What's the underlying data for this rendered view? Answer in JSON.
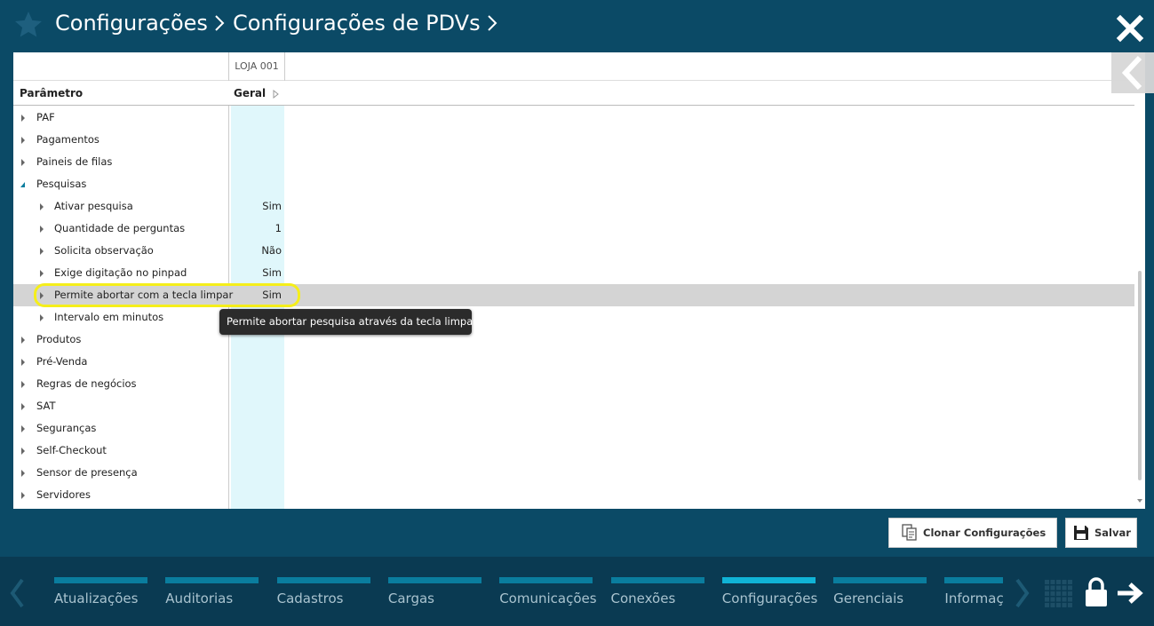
{
  "header": {
    "crumb1": "Configurações",
    "crumb2": "Configurações de PDVs"
  },
  "table": {
    "store_column": "LOJA 001",
    "param_header": "Parâmetro",
    "group_header": "Geral",
    "rows": [
      {
        "label": "PAF",
        "value": "",
        "level": 1,
        "expanded": false
      },
      {
        "label": "Pagamentos",
        "value": "",
        "level": 1,
        "expanded": false
      },
      {
        "label": "Paineis de filas",
        "value": "",
        "level": 1,
        "expanded": false
      },
      {
        "label": "Pesquisas",
        "value": "",
        "level": 1,
        "expanded": true
      },
      {
        "label": "Ativar pesquisa",
        "value": "Sim",
        "level": 2,
        "expanded": false
      },
      {
        "label": "Quantidade de perguntas",
        "value": "1",
        "level": 2,
        "expanded": false
      },
      {
        "label": "Solicita observação",
        "value": "Não",
        "level": 2,
        "expanded": false
      },
      {
        "label": "Exige digitação no pinpad",
        "value": "Sim",
        "level": 2,
        "expanded": false
      },
      {
        "label": "Permite abortar com a tecla limpar",
        "value": "Sim",
        "level": 2,
        "expanded": false,
        "selected": true
      },
      {
        "label": "Intervalo em minutos",
        "value": "",
        "level": 2,
        "expanded": false
      },
      {
        "label": "Produtos",
        "value": "",
        "level": 1,
        "expanded": false
      },
      {
        "label": "Pré-Venda",
        "value": "",
        "level": 1,
        "expanded": false
      },
      {
        "label": "Regras de negócios",
        "value": "",
        "level": 1,
        "expanded": false
      },
      {
        "label": "SAT",
        "value": "",
        "level": 1,
        "expanded": false
      },
      {
        "label": "Seguranças",
        "value": "",
        "level": 1,
        "expanded": false
      },
      {
        "label": "Self-Checkout",
        "value": "",
        "level": 1,
        "expanded": false
      },
      {
        "label": "Sensor de presença",
        "value": "",
        "level": 1,
        "expanded": false
      },
      {
        "label": "Servidores",
        "value": "",
        "level": 1,
        "expanded": false
      }
    ],
    "tooltip": "Permite abortar pesquisa através da tecla limpar"
  },
  "actions": {
    "clone_label": "Clonar Configurações",
    "save_label": "Salvar"
  },
  "bottom_nav": {
    "items": [
      {
        "label": "Atualizações",
        "active": false
      },
      {
        "label": "Auditorias",
        "active": false
      },
      {
        "label": "Cadastros",
        "active": false
      },
      {
        "label": "Cargas",
        "active": false
      },
      {
        "label": "Comunicações",
        "active": false
      },
      {
        "label": "Conexões",
        "active": false
      },
      {
        "label": "Configurações",
        "active": true
      },
      {
        "label": "Gerenciais",
        "active": false
      },
      {
        "label": "Informações",
        "active": false
      }
    ]
  },
  "colors": {
    "header_bg": "#0b4a66",
    "footer_bg": "#0a3a52",
    "nav_bar": "#0a7d9e",
    "nav_bar_active": "#10b3d6",
    "column_highlight": "#e0f7fb",
    "selected_row": "#d4d4d4",
    "highlight_ring": "#f5ee1a"
  },
  "icons": {
    "favorite": "star-icon",
    "close": "close-icon",
    "collapse_panel": "chevron-left-icon",
    "clone": "clone-icon",
    "save": "floppy-disk-icon",
    "apps": "grid-icon",
    "lock": "lock-icon",
    "logout": "arrow-right-icon"
  }
}
